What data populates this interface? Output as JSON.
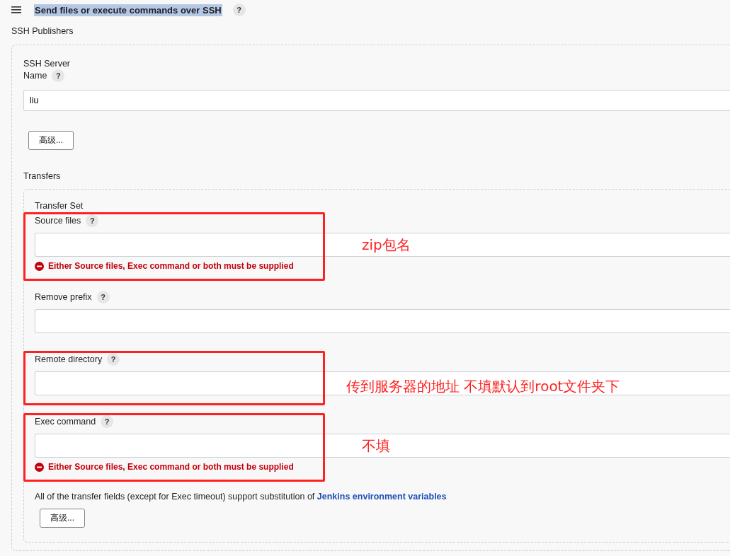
{
  "header": {
    "title": "Send files or execute commands over SSH",
    "selected": true,
    "help": "?"
  },
  "section_label": "SSH Publishers",
  "server": {
    "group_label": "SSH Server",
    "name_label": "Name",
    "help": "?",
    "name_value": "liu",
    "advanced_button": "高级..."
  },
  "transfers_label": "Transfers",
  "transfer_set": {
    "label": "Transfer Set",
    "fields": [
      {
        "label": "Source files",
        "help": "?",
        "error": "Either Source files, Exec command or both must be supplied",
        "annotation": {
          "note": "zip包名"
        }
      },
      {
        "label": "Remove prefix",
        "help": "?"
      },
      {
        "label": "Remote directory",
        "help": "?",
        "annotation": {
          "note": "传到服务器的地址 不填默认到root文件夹下"
        }
      },
      {
        "label": "Exec command",
        "help": "?",
        "error": "Either Source files, Exec command or both must be supplied",
        "annotation": {
          "note": "不填"
        }
      }
    ],
    "footnote": {
      "text": "All of the transfer fields (except for Exec timeout) support substitution of",
      "link": "Jenkins environment variables"
    },
    "advanced_button": "高级..."
  }
}
